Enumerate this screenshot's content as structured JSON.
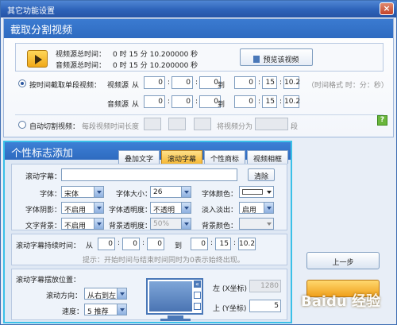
{
  "window": {
    "title": "其它功能设置",
    "close": "×"
  },
  "capture": {
    "header": "截取分割视频",
    "video_total_label": "视频源总时间：",
    "video_total_value": "0  时 15  分 10.200000 秒",
    "audio_total_label": "音频源总时间：",
    "audio_total_value": "0  时 15  分 10.200000 秒",
    "preview_button": "预览该视频",
    "single_segment": {
      "label": "按时间截取单段视频：",
      "video_label": "视频源",
      "audio_label": "音频源",
      "from": "从",
      "to": "到",
      "video_from": [
        "0",
        "0",
        "0"
      ],
      "video_to": [
        "0",
        "15",
        "10.2"
      ],
      "audio_from": [
        "0",
        "0",
        "0"
      ],
      "audio_to": [
        "0",
        "15",
        "10.2"
      ],
      "format_hint": "（时间格式 时：分：秒）",
      "help": "?"
    },
    "auto_split": {
      "label": "自动切割视频：",
      "segment_length_label": "每段视频时间长度",
      "values": [
        "",
        "",
        ""
      ],
      "split_into_label": "将视频分为",
      "segments_value": "",
      "unit": "段"
    }
  },
  "personal": {
    "header": "个性标志添加",
    "tabs": [
      "叠加文字",
      "滚动字幕",
      "个性商标",
      "视频相框"
    ],
    "active_tab": 1,
    "scroll_text_label": "滚动字幕：",
    "scroll_text_value": "",
    "clear_button": "清除",
    "font_label": "字体：",
    "font_value": "宋体",
    "font_size_label": "字体大小：",
    "font_size_value": "26",
    "font_color_label": "字体颜色：",
    "font_color_value": "#ffffff",
    "shadow_label": "字体阴影：",
    "shadow_value": "不启用",
    "transparency_label": "字体透明度：",
    "transparency_value": "不透明",
    "fade_label": "淡入淡出：",
    "fade_value": "启用",
    "bg_label": "文字背景：",
    "bg_value": "不启用",
    "bg_transparency_label": "背景透明度：",
    "bg_transparency_value": "50%",
    "bg_color_label": "背景颜色：",
    "duration_label": "滚动字幕持续时间：",
    "from": "从",
    "to": "到",
    "duration_from": [
      "0",
      "0",
      "0"
    ],
    "duration_to": [
      "0",
      "15",
      "10.2"
    ],
    "duration_hint": "提示：开始时间与结束时间同时为0表示始终出现。",
    "position_label": "滚动字幕摆放位置：",
    "direction_label": "滚动方向：",
    "direction_value": "从右到左",
    "speed_label": "速度：",
    "speed_value": "5 推荐",
    "left_label": "左 (X坐标)",
    "left_value": "1280",
    "top_label": "上 (Y坐标)",
    "top_value": "5",
    "monitor_close": "«"
  },
  "side_buttons": {
    "prev": "上一步",
    "next": ""
  },
  "watermark": "Baidu 经验"
}
